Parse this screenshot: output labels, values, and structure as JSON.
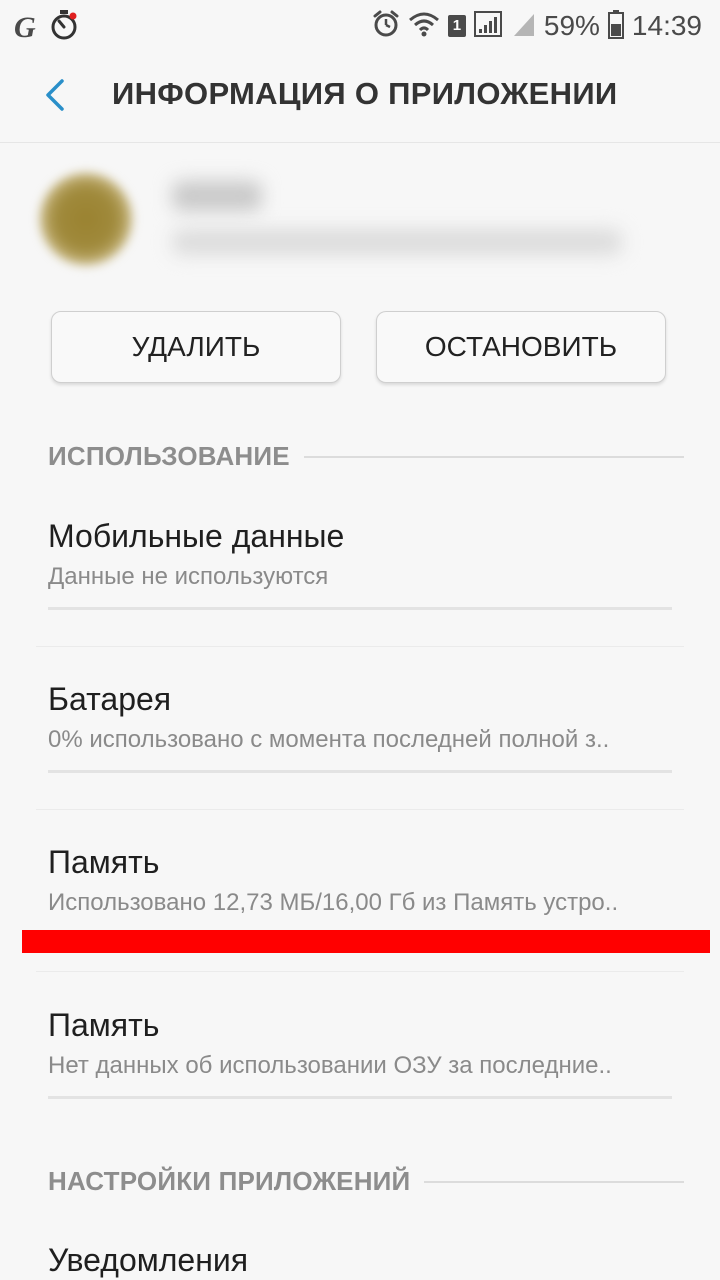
{
  "status_bar": {
    "left_icons": [
      "g-icon",
      "timer-icon"
    ],
    "carrier_glyph": "G",
    "sim_badge": "1",
    "battery_percent": "59%",
    "time": "14:39"
  },
  "app_bar": {
    "back_icon": "chevron-left-icon",
    "title": "ИНФОРМАЦИЯ О ПРИЛОЖЕНИИ",
    "accent_color": "#2a8fc9"
  },
  "app_header": {
    "icon": "app-icon",
    "name": "",
    "version": ""
  },
  "actions": {
    "delete_label": "УДАЛИТЬ",
    "stop_label": "ОСТАНОВИТЬ"
  },
  "usage_section": {
    "title": "ИСПОЛЬЗОВАНИЕ",
    "items": [
      {
        "title": "Мобильные данные",
        "subtitle": "Данные не используются"
      },
      {
        "title": "Батарея",
        "subtitle": "0% использовано с момента последней полной з.."
      },
      {
        "title": "Память",
        "subtitle": "Использовано 12,73 МБ/16,00 Гб из Память устро.."
      },
      {
        "title": "Память",
        "subtitle": "Нет данных об использовании ОЗУ за последние.."
      }
    ]
  },
  "app_settings_section": {
    "title": "НАСТРОЙКИ ПРИЛОЖЕНИЙ",
    "items": [
      {
        "title": "Уведомления"
      }
    ]
  },
  "annotation_color": "#ff0000"
}
